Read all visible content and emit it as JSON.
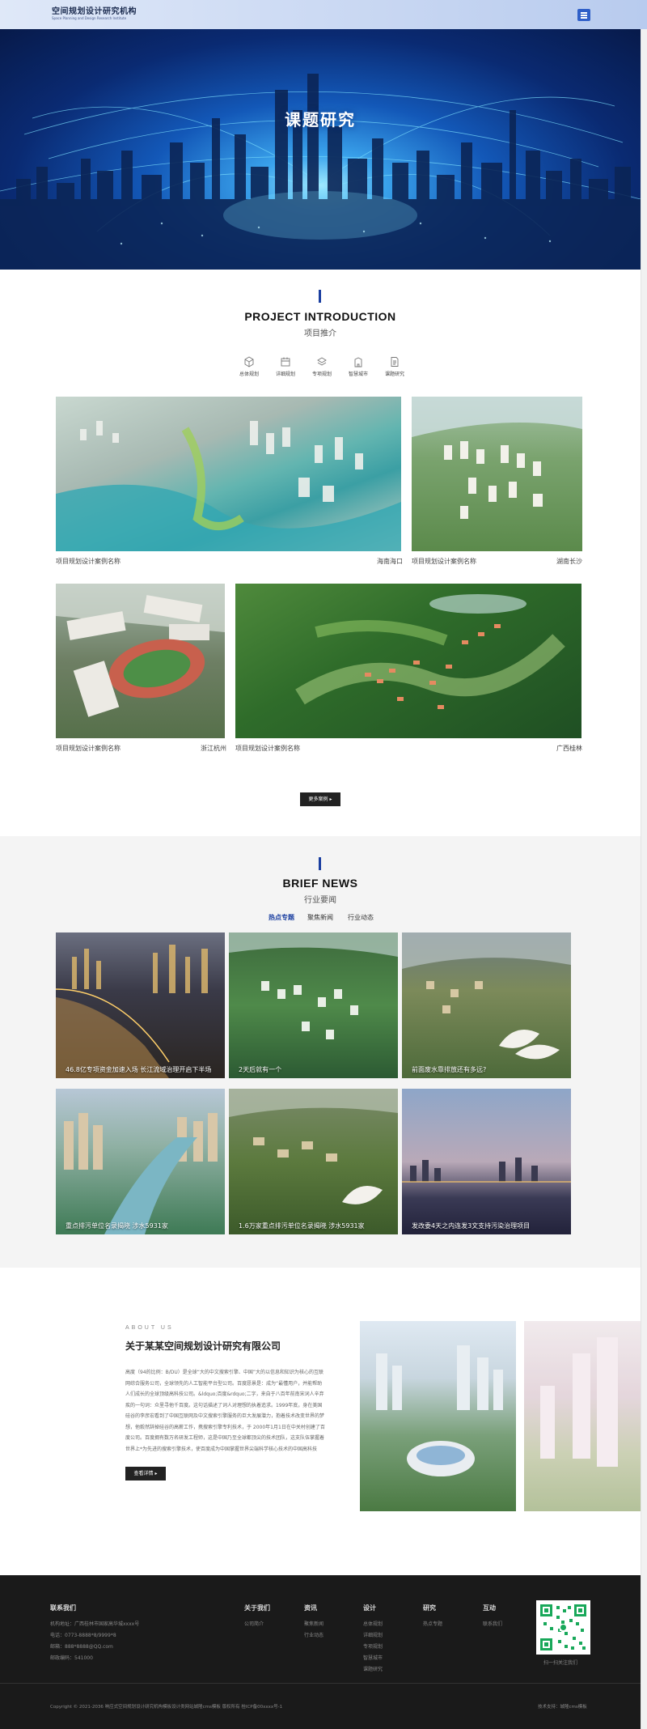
{
  "header": {
    "logo_cn": "空间规划设计研究机构",
    "logo_en": "Space Planning and Design Research Institute",
    "menu_icon": "hamburger-menu-icon",
    "bg_colors": [
      "#dfe8f8",
      "#b8cbee"
    ],
    "accent": "#2f5fc8"
  },
  "hero": {
    "title": "课题研究"
  },
  "project": {
    "title": "PROJECT INTRODUCTION",
    "subtitle": "项目推介",
    "categories": [
      {
        "label": "总体规划",
        "icon": "cube-icon"
      },
      {
        "label": "详细规划",
        "icon": "calendar-icon"
      },
      {
        "label": "专项规划",
        "icon": "layers-icon"
      },
      {
        "label": "智慧城市",
        "icon": "building-icon"
      },
      {
        "label": "课题研究",
        "icon": "document-icon"
      }
    ],
    "cases": [
      {
        "name": "项目规划设计案例名称",
        "city": "海南海口"
      },
      {
        "name": "项目规划设计案例名称",
        "city": "湖南长沙"
      },
      {
        "name": "项目规划设计案例名称",
        "city": "浙江杭州"
      },
      {
        "name": "项目规划设计案例名称",
        "city": "广西桂林"
      }
    ],
    "more_label": "更多案例 ▸"
  },
  "news": {
    "title": "BRIEF NEWS",
    "subtitle": "行业要闻",
    "tabs": [
      "热点专题",
      "聚焦新闻",
      "行业动态"
    ],
    "active_tab_color": "#1b3fa0",
    "items": [
      {
        "title": "46.8亿专项资金加速入场 长江流域治理开启下半场"
      },
      {
        "title": "2天后就有一个"
      },
      {
        "title": "前面废水靠排放还有多远?"
      },
      {
        "title": "重点排污单位名录揭晓 涉水5931家"
      },
      {
        "title": "1.6万家重点排污单位名录揭晓 涉水5931家"
      },
      {
        "title": "发改委4天之内连发3文支持污染治理项目"
      }
    ]
  },
  "about": {
    "label": "ABOUT US",
    "title": "关于某某空间规划设计研究有限公司",
    "text": "高度（94的比例：B/DU）是全球“大的中文搜索引擎、中国”大的以信息和知识为核心的互联网综合服务公司，全球领先的人工智能平台型公司。百度愿景是：成为“最懂用户，并能帮助人们成长的全球顶级高科技公司。&ldquo;百度&rdquo;二字，来自于八百年前南宋词人辛弃疾的一句词：众里寻他千百度。这句话描述了词人对理想的执着追求。1999年底，身在美国硅谷的李彦宏看到了中国互联网及中文搜索引擎服务的巨大发展潜力，抱着技术改变世界的梦想，他毅然辞掉硅谷的高薪工作，携搜索引擎专利技术，于 2000年1月1日在中关村创建了百度公司。百度拥有数万名研发工程师，这是中国乃至全球都顶尖的技术团队，这支队伍掌握着世界上*为先进的搜索引擎技术，使百度成为中国掌握世界尖端科学核心技术的中国高科技",
    "button_label": "查看详情 ▸"
  },
  "footer": {
    "contact_title": "联系我们",
    "contact_lines": [
      "机构地址：广西桂林市国家高华城xxxx号",
      "电话：0773-8888*8/9999*8",
      "邮箱：888*8888@QQ.com",
      "邮政编码：541000"
    ],
    "columns": [
      {
        "title": "关于我们",
        "items": [
          "公司简介"
        ]
      },
      {
        "title": "资讯",
        "items": [
          "聚焦新闻",
          "行业动态"
        ]
      },
      {
        "title": "设计",
        "items": [
          "总体规划",
          "详细规划",
          "专项规划",
          "智慧城市",
          "课题研究"
        ]
      },
      {
        "title": "研究",
        "items": [
          "热点专题"
        ]
      },
      {
        "title": "互动",
        "items": [
          "联系我们"
        ]
      }
    ],
    "qr_caption": "扫一扫关注我们",
    "copyright": "Copyright © 2021-2036 响应式空间规划设计研究机构模板设计类网站城隆cms模板 版权所有   桂ICP备00xxxx号-1",
    "tech": "技术支持：城隆cms模板"
  }
}
